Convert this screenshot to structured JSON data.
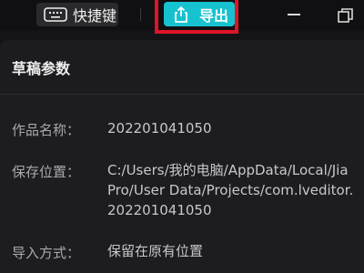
{
  "toolbar": {
    "shortcut_label": "快捷键",
    "export_label": "导出"
  },
  "panel": {
    "title": "草稿参数",
    "fields": [
      {
        "label": "作品名称：",
        "value_lines": [
          "202201041050"
        ]
      },
      {
        "label": "保存位置：",
        "value_lines": [
          "C:/Users/我的电脑/AppData/Local/Jia",
          "Pro/User Data/Projects/com.lveditor.",
          "202201041050"
        ]
      },
      {
        "label": "导入方式：",
        "value_lines": [
          "保留在原有位置"
        ]
      }
    ]
  },
  "colors": {
    "export_button": "#16c2cf",
    "highlight_box": "#e01426"
  },
  "icons": {
    "shortcut": "keyboard-icon",
    "export": "upload-icon",
    "minimize": "minimize-icon",
    "restore": "restore-icon"
  }
}
